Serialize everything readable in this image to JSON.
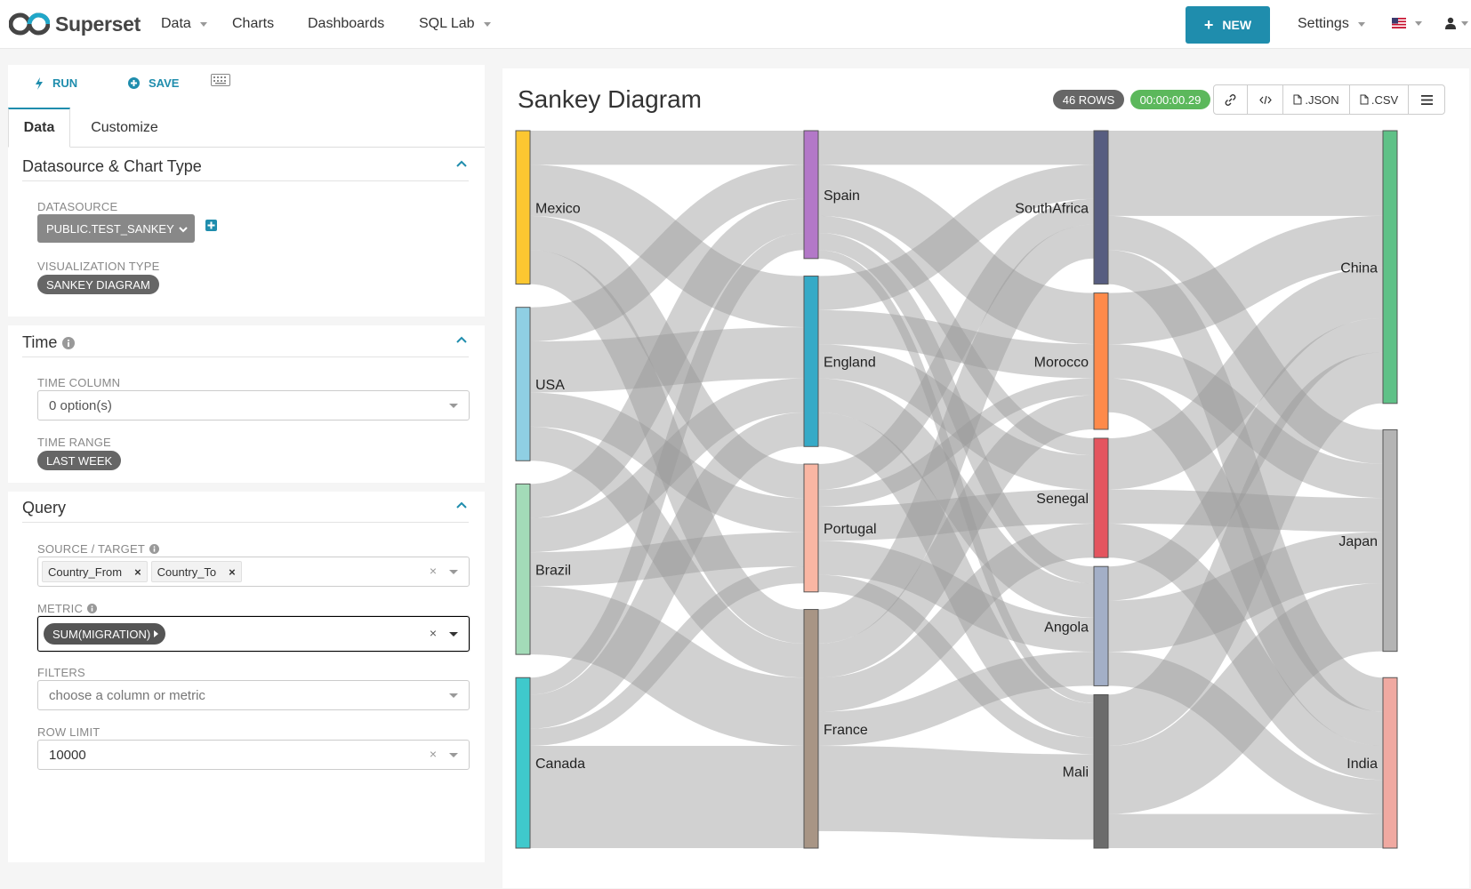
{
  "navbar": {
    "brand": "Superset",
    "items": [
      "Data",
      "Charts",
      "Dashboards",
      "SQL Lab"
    ],
    "new_label": "NEW",
    "settings_label": "Settings"
  },
  "toolbar": {
    "run_label": "RUN",
    "save_label": "SAVE"
  },
  "tabs": {
    "data": "Data",
    "customize": "Customize"
  },
  "sections": {
    "datasource": {
      "title": "Datasource & Chart Type",
      "datasource_label": "DATASOURCE",
      "datasource_value": "PUBLIC.TEST_SANKEY",
      "viz_label": "VISUALIZATION TYPE",
      "viz_value": "SANKEY DIAGRAM"
    },
    "time": {
      "title": "Time",
      "column_label": "TIME COLUMN",
      "column_value": "0 option(s)",
      "range_label": "TIME RANGE",
      "range_value": "LAST WEEK"
    },
    "query": {
      "title": "Query",
      "source_label": "SOURCE / TARGET",
      "source_tags": [
        "Country_From",
        "Country_To"
      ],
      "metric_label": "METRIC",
      "metric_value": "SUM(MIGRATION)",
      "filters_label": "FILTERS",
      "filters_placeholder": "choose a column or metric",
      "row_limit_label": "ROW LIMIT",
      "row_limit_value": "10000"
    }
  },
  "chart": {
    "title": "Sankey Diagram",
    "rows_badge": "46 ROWS",
    "time_badge": "00:00:00.29",
    "json_label": ".JSON",
    "csv_label": ".CSV",
    "colors": {
      "rows": "#666666",
      "time": "#5cb85c",
      "accent": "#1f8dad"
    }
  },
  "chart_data": {
    "type": "sankey",
    "nodes": [
      {
        "name": "Mexico",
        "color": "#fcc731",
        "col": 0
      },
      {
        "name": "USA",
        "color": "#8fcfe3",
        "col": 0
      },
      {
        "name": "Brazil",
        "color": "#a3dbb8",
        "col": 0
      },
      {
        "name": "Canada",
        "color": "#3fc9cc",
        "col": 0
      },
      {
        "name": "Spain",
        "color": "#b378c8",
        "col": 1
      },
      {
        "name": "England",
        "color": "#36aac7",
        "col": 1
      },
      {
        "name": "Portugal",
        "color": "#f9b6a3",
        "col": 1
      },
      {
        "name": "France",
        "color": "#a89585",
        "col": 1
      },
      {
        "name": "SouthAfrica",
        "color": "#575d80",
        "col": 2
      },
      {
        "name": "Morocco",
        "color": "#fe8a4a",
        "col": 2
      },
      {
        "name": "Senegal",
        "color": "#e4555f",
        "col": 2
      },
      {
        "name": "Angola",
        "color": "#a3afc7",
        "col": 2
      },
      {
        "name": "Mali",
        "color": "#6b6b6b",
        "col": 2
      },
      {
        "name": "China",
        "color": "#5fc187",
        "col": 3
      },
      {
        "name": "Japan",
        "color": "#b4b4b4",
        "col": 3
      },
      {
        "name": "India",
        "color": "#f0a9a1",
        "col": 3
      }
    ],
    "links": [
      [
        "Mexico",
        "Spain",
        2
      ],
      [
        "Mexico",
        "England",
        3
      ],
      [
        "Mexico",
        "Portugal",
        2
      ],
      [
        "Mexico",
        "France",
        2
      ],
      [
        "USA",
        "Spain",
        2
      ],
      [
        "USA",
        "England",
        3
      ],
      [
        "USA",
        "Portugal",
        2
      ],
      [
        "USA",
        "France",
        2
      ],
      [
        "Brazil",
        "Spain",
        2
      ],
      [
        "Brazil",
        "England",
        2
      ],
      [
        "Brazil",
        "Portugal",
        2
      ],
      [
        "Brazil",
        "France",
        4
      ],
      [
        "Canada",
        "Spain",
        1
      ],
      [
        "Canada",
        "England",
        2
      ],
      [
        "Canada",
        "Portugal",
        1
      ],
      [
        "Canada",
        "France",
        6
      ],
      [
        "Spain",
        "SouthAfrica",
        2
      ],
      [
        "Spain",
        "Morocco",
        3
      ],
      [
        "Spain",
        "Senegal",
        1
      ],
      [
        "Spain",
        "Angola",
        1
      ],
      [
        "Spain",
        "Mali",
        0.5
      ],
      [
        "England",
        "SouthAfrica",
        2
      ],
      [
        "England",
        "Morocco",
        2
      ],
      [
        "England",
        "Senegal",
        2
      ],
      [
        "England",
        "Angola",
        2
      ],
      [
        "England",
        "Mali",
        2
      ],
      [
        "Portugal",
        "SouthAfrica",
        1.5
      ],
      [
        "Portugal",
        "Morocco",
        1
      ],
      [
        "Portugal",
        "Senegal",
        2
      ],
      [
        "Portugal",
        "Angola",
        2
      ],
      [
        "Portugal",
        "Mali",
        1
      ],
      [
        "France",
        "SouthAfrica",
        2
      ],
      [
        "France",
        "Morocco",
        2
      ],
      [
        "France",
        "Senegal",
        2
      ],
      [
        "France",
        "Angola",
        2
      ],
      [
        "France",
        "Mali",
        5
      ],
      [
        "SouthAfrica",
        "China",
        5
      ],
      [
        "SouthAfrica",
        "Japan",
        2
      ],
      [
        "SouthAfrica",
        "India",
        2
      ],
      [
        "Morocco",
        "China",
        3
      ],
      [
        "Morocco",
        "Japan",
        2
      ],
      [
        "Morocco",
        "India",
        2
      ],
      [
        "Senegal",
        "China",
        3
      ],
      [
        "Senegal",
        "Japan",
        2
      ],
      [
        "Senegal",
        "India",
        2
      ],
      [
        "Angola",
        "China",
        2
      ],
      [
        "Angola",
        "Japan",
        3
      ],
      [
        "Angola",
        "India",
        2
      ],
      [
        "Mali",
        "China",
        3
      ],
      [
        "Mali",
        "Japan",
        4
      ],
      [
        "Mali",
        "India",
        2
      ]
    ]
  }
}
